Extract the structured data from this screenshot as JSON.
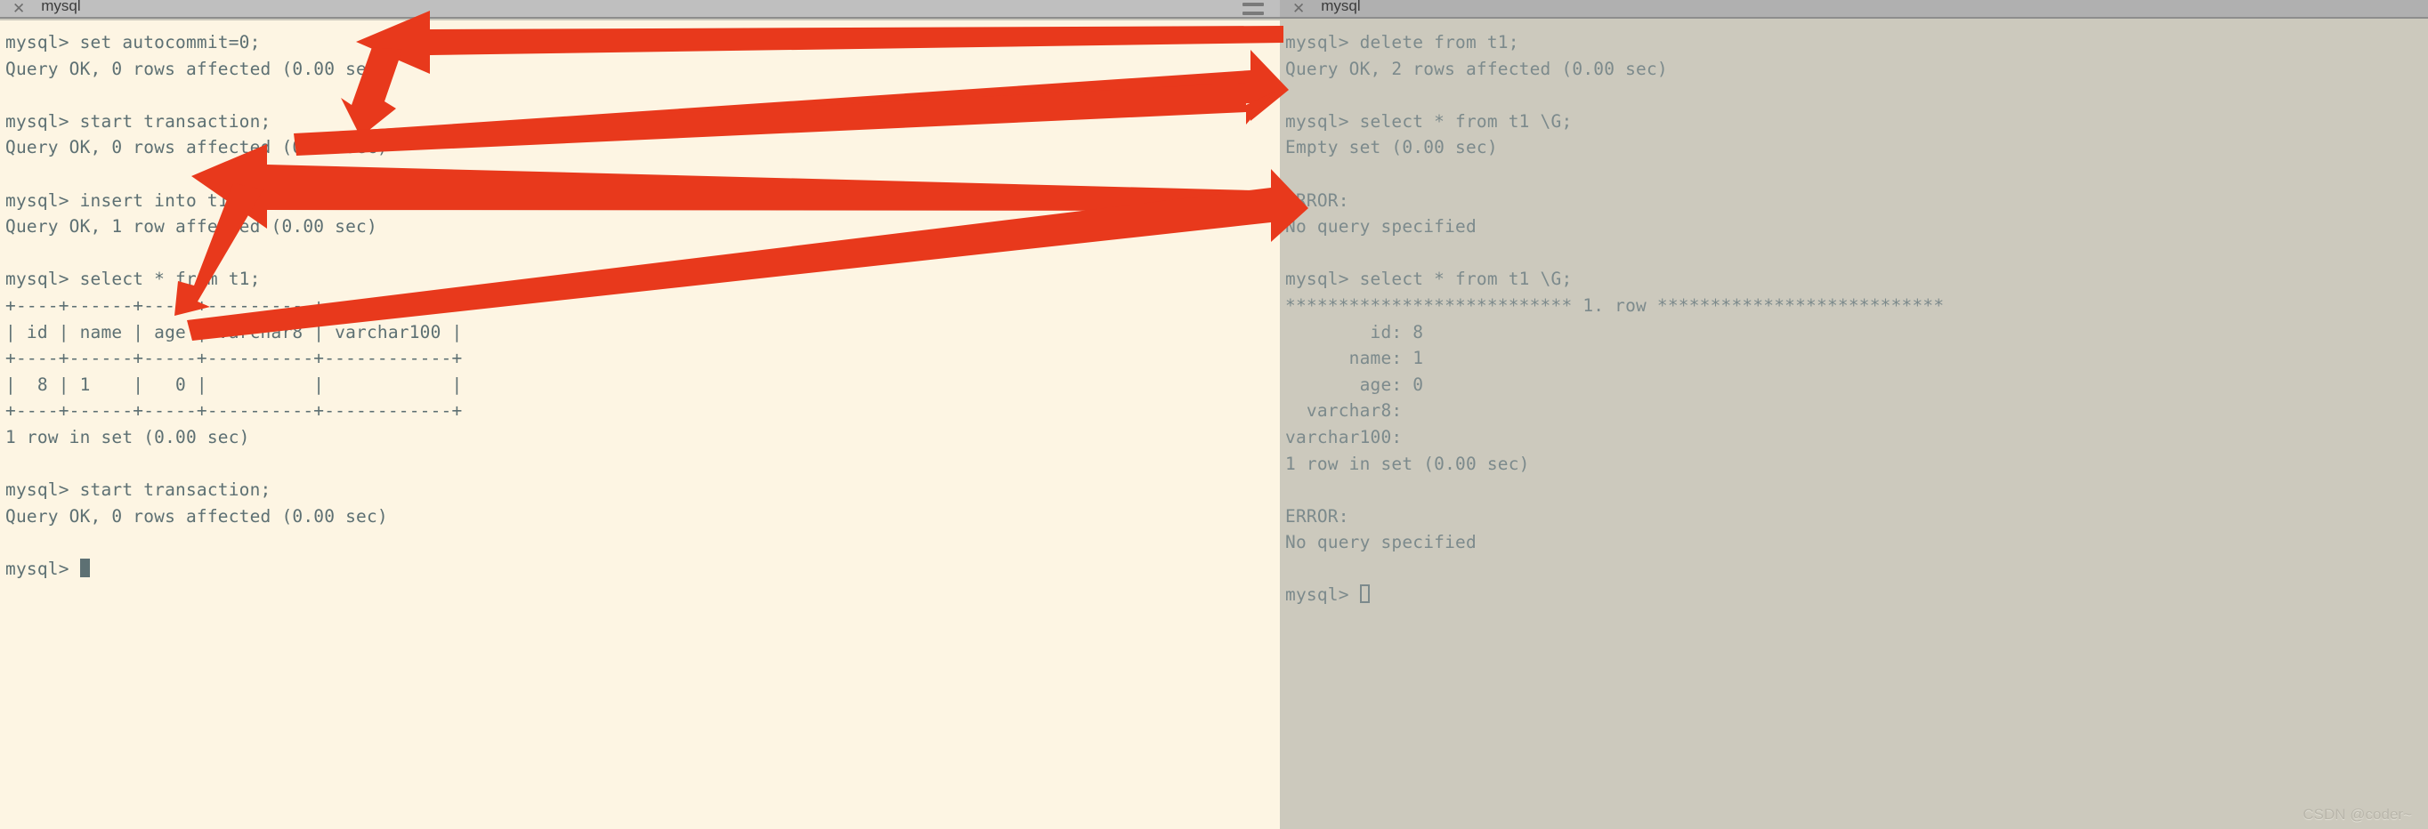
{
  "watermark": "CSDN @coder~",
  "colors": {
    "left_bg": "#fdf5e3",
    "right_bg": "#ccc9bd",
    "left_text": "#5d7073",
    "right_text": "#7c8a8c",
    "titlebar_left": "#bfbfbf",
    "titlebar_right": "#b0b0b0",
    "arrow": "#e8391c"
  },
  "left_window": {
    "title": "mysql",
    "close_label": "✕",
    "menu_icon": "hamburger-icon",
    "cursor": "block-filled",
    "prompt": "mysql> ",
    "lines": [
      "mysql> set autocommit=0;",
      "Query OK, 0 rows affected (0.00 sec)",
      "",
      "mysql> start transaction;",
      "Query OK, 0 rows affected (0.00 sec)",
      "",
      "mysql> insert into t1 (name) values(1);",
      "Query OK, 1 row affected (0.00 sec)",
      "",
      "mysql> select * from t1;",
      "+----+------+-----+----------+------------+",
      "| id | name | age | varchar8 | varchar100 |",
      "+----+------+-----+----------+------------+",
      "|  8 | 1    |   0 |          |            |",
      "+----+------+-----+----------+------------+",
      "1 row in set (0.00 sec)",
      "",
      "mysql> start transaction;",
      "Query OK, 0 rows affected (0.00 sec)",
      ""
    ]
  },
  "right_window": {
    "title": "mysql",
    "close_label": "✕",
    "cursor": "block-hollow",
    "prompt": "mysql> ",
    "lines": [
      "mysql> delete from t1;",
      "Query OK, 2 rows affected (0.00 sec)",
      "",
      "mysql> select * from t1 \\G;",
      "Empty set (0.00 sec)",
      "",
      "ERROR:",
      "No query specified",
      "",
      "mysql> select * from t1 \\G;",
      "*************************** 1. row ***************************",
      "        id: 8",
      "      name: 1",
      "       age: 0",
      "  varchar8:",
      "varchar100:",
      "1 row in set (0.00 sec)",
      "",
      "ERROR:",
      "No query specified",
      ""
    ]
  },
  "annotations": {
    "arrow_count": 5,
    "arrows": [
      {
        "name": "arrow-delete-to-autocommit",
        "from": "right-pane delete from t1",
        "to": "left-pane set autocommit=0;"
      },
      {
        "name": "arrow-start-transaction-to-empty-set",
        "from": "left-pane start transaction;",
        "to": "right-pane Empty set (0.00 sec)"
      },
      {
        "name": "arrow-insert-to-empty-set",
        "from": "left-pane insert into t1 (name) values(1);",
        "to": "right-pane Empty set (0.00 sec)"
      },
      {
        "name": "arrow-select-to-result-row",
        "from": "right-pane 1. row separator",
        "to": "left-pane select * from t1;"
      },
      {
        "name": "arrow-start-transaction2-to-result-row",
        "from": "left-pane start transaction; (second)",
        "to": "right-pane 1. row separator"
      }
    ]
  }
}
